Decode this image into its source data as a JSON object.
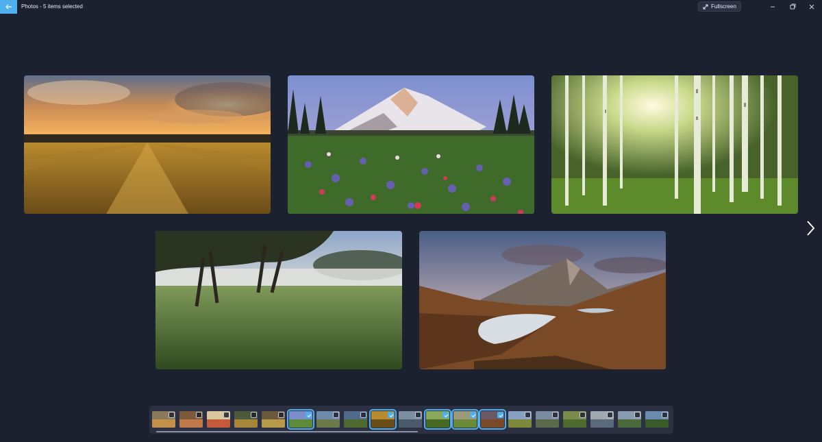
{
  "window": {
    "title": "Photos - 5 items selected",
    "fullscreen_label": "Fullscreen"
  },
  "colors": {
    "background": "#1c2130",
    "accent": "#4fb0ef",
    "filmstrip_bg": "#2b3142"
  },
  "icons": {
    "back": "arrow-left-icon",
    "fullscreen": "expand-diagonal-icon",
    "minimize": "minimize-icon",
    "restore": "restore-icon",
    "close": "close-icon",
    "next": "chevron-right-icon",
    "check": "checkmark-icon"
  },
  "photos": [
    {
      "name": "wheat-field-sunset"
    },
    {
      "name": "mountain-wildflower-meadow"
    },
    {
      "name": "sunlit-birch-forest"
    },
    {
      "name": "misty-meadow-trees"
    },
    {
      "name": "mountain-lake-valley"
    }
  ],
  "filmstrip": {
    "thumbnails": [
      {
        "selected": false
      },
      {
        "selected": false
      },
      {
        "selected": false
      },
      {
        "selected": false
      },
      {
        "selected": false
      },
      {
        "selected": true
      },
      {
        "selected": false
      },
      {
        "selected": false
      },
      {
        "selected": true
      },
      {
        "selected": false
      },
      {
        "selected": true
      },
      {
        "selected": true
      },
      {
        "selected": true
      },
      {
        "selected": false
      },
      {
        "selected": false
      },
      {
        "selected": false
      },
      {
        "selected": false
      },
      {
        "selected": false
      },
      {
        "selected": false
      }
    ],
    "selected_count": 5
  }
}
